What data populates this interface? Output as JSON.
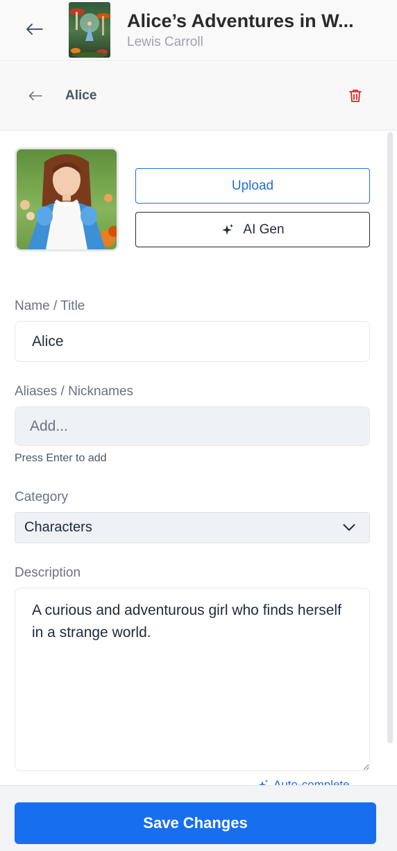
{
  "header": {
    "book_title": "Alice’s Adventures in W...",
    "author": "Lewis Carroll"
  },
  "entity": {
    "name": "Alice"
  },
  "image_actions": {
    "upload_label": "Upload",
    "ai_gen_label": "AI Gen"
  },
  "form": {
    "name_label": "Name / Title",
    "name_value": "Alice",
    "aliases_label": "Aliases / Nicknames",
    "aliases_placeholder": "Add...",
    "aliases_hint": "Press Enter to add",
    "category_label": "Category",
    "category_value": "Characters",
    "description_label": "Description",
    "description_value": "A curious and adventurous girl who finds herself in a strange world.",
    "autocomplete_label": "Auto-complete"
  },
  "footer": {
    "save_label": "Save Changes"
  },
  "colors": {
    "accent": "#176ff0",
    "danger": "#dc2626"
  }
}
